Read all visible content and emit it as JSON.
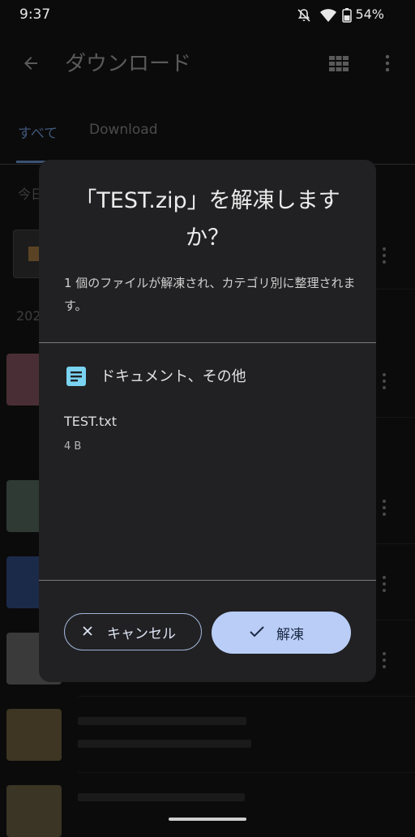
{
  "status_bar": {
    "time": "9:37",
    "battery": "54%"
  },
  "app_bar": {
    "title": "ダウンロード"
  },
  "tabs": [
    {
      "label": "すべて"
    },
    {
      "label": "Download"
    }
  ],
  "background": {
    "section_today": "今日",
    "section_year": "202"
  },
  "dialog": {
    "title": "「TEST.zip」を解凍しますか？",
    "message": "1 個のファイルが解凍され、カテゴリ別に整理されます。",
    "category": "ドキュメント、その他",
    "file_name": "TEST.txt",
    "file_size": "4 B",
    "cancel_label": "キャンセル",
    "extract_label": "解凍"
  },
  "colors": {
    "accent": "#b9cdf7",
    "dialog_bg": "#212123",
    "doc_icon": "#7ad3f0"
  }
}
